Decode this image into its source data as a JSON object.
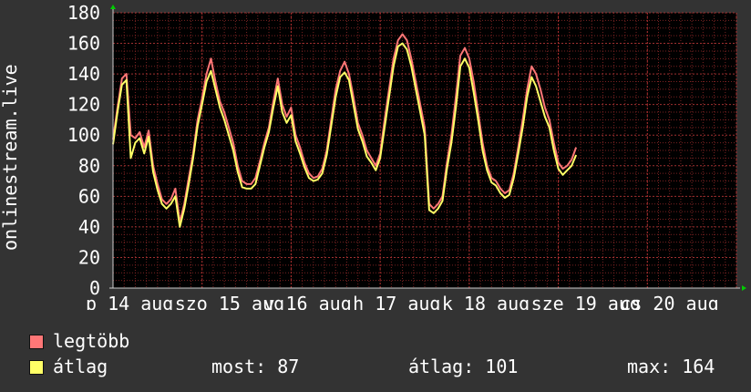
{
  "chart_data": {
    "type": "line",
    "ylabel": "onlinestream.live",
    "ylim": [
      0,
      180
    ],
    "y_ticks": [
      0,
      20,
      40,
      60,
      80,
      100,
      120,
      140,
      160,
      180
    ],
    "x_tick_labels": [
      "p 14 aug",
      "szo 15 aug",
      "v 16 aug",
      "h 17 aug",
      "k 18 aug",
      "sze 19 aug",
      "cs 20 aug"
    ],
    "grid": true,
    "colors": {
      "background": "#333333",
      "plot": "#000000",
      "grid": "#7a2222",
      "max_line": "#ff7777",
      "avg_line": "#ffff66",
      "text": "#ffffff"
    },
    "x_days": [
      14.0,
      14.05,
      14.1,
      14.15,
      14.2,
      14.25,
      14.3,
      14.35,
      14.4,
      14.45,
      14.5,
      14.55,
      14.6,
      14.65,
      14.7,
      14.75,
      14.8,
      14.85,
      14.9,
      14.95,
      15.0,
      15.05,
      15.1,
      15.15,
      15.2,
      15.25,
      15.3,
      15.35,
      15.4,
      15.45,
      15.5,
      15.55,
      15.6,
      15.65,
      15.7,
      15.75,
      15.8,
      15.85,
      15.9,
      15.95,
      16.0,
      16.05,
      16.1,
      16.15,
      16.2,
      16.25,
      16.3,
      16.35,
      16.4,
      16.45,
      16.5,
      16.55,
      16.6,
      16.65,
      16.7,
      16.75,
      16.8,
      16.85,
      16.9,
      16.95,
      17.0,
      17.05,
      17.1,
      17.15,
      17.2,
      17.25,
      17.3,
      17.35,
      17.4,
      17.45,
      17.5,
      17.55,
      17.6,
      17.65,
      17.7,
      17.75,
      17.8,
      17.85,
      17.9,
      17.95,
      18.0,
      18.05,
      18.1,
      18.15,
      18.2,
      18.25,
      18.3,
      18.35,
      18.4,
      18.45,
      18.5,
      18.55,
      18.6,
      18.65,
      18.7,
      18.75,
      18.8,
      18.85,
      18.9,
      18.95,
      19.0,
      19.05,
      19.1,
      19.15,
      19.2,
      19.25,
      19.3,
      19.35,
      19.4,
      19.45,
      19.5,
      19.55,
      19.6,
      19.65,
      19.7,
      19.75,
      19.8,
      19.85,
      19.9,
      19.95,
      20.0,
      20.05,
      20.1,
      20.15,
      20.2,
      20.25,
      20.3,
      20.35,
      20.4,
      20.45,
      20.5,
      20.55,
      20.6,
      20.65,
      20.7,
      20.75,
      20.8,
      20.85,
      20.9,
      20.95,
      21.0
    ],
    "series": [
      {
        "name": "legtöbb",
        "values": [
          97,
          118,
          137,
          140,
          100,
          98,
          102,
          92,
          103,
          80,
          68,
          58,
          55,
          58,
          65,
          43,
          55,
          72,
          88,
          110,
          124,
          140,
          150,
          135,
          122,
          115,
          105,
          95,
          80,
          70,
          68,
          68,
          72,
          83,
          95,
          105,
          122,
          137,
          120,
          112,
          118,
          100,
          92,
          82,
          75,
          72,
          73,
          78,
          90,
          110,
          130,
          142,
          148,
          140,
          125,
          108,
          100,
          90,
          85,
          80,
          88,
          110,
          130,
          150,
          162,
          166,
          162,
          150,
          135,
          120,
          105,
          55,
          52,
          55,
          60,
          82,
          100,
          125,
          152,
          157,
          150,
          135,
          115,
          95,
          80,
          72,
          70,
          65,
          62,
          64,
          75,
          92,
          110,
          130,
          145,
          140,
          130,
          118,
          110,
          95,
          82,
          78,
          80,
          84,
          92
        ]
      },
      {
        "name": "átlag",
        "values": [
          94,
          115,
          133,
          136,
          85,
          95,
          98,
          88,
          99,
          76,
          64,
          55,
          52,
          55,
          60,
          40,
          52,
          68,
          85,
          106,
          120,
          135,
          142,
          130,
          118,
          110,
          100,
          90,
          76,
          66,
          65,
          65,
          68,
          80,
          92,
          102,
          118,
          132,
          115,
          108,
          113,
          96,
          88,
          79,
          72,
          70,
          71,
          75,
          87,
          106,
          125,
          138,
          141,
          136,
          120,
          104,
          96,
          86,
          82,
          77,
          85,
          105,
          125,
          145,
          158,
          160,
          156,
          145,
          130,
          115,
          100,
          51,
          49,
          52,
          57,
          78,
          95,
          118,
          145,
          150,
          144,
          128,
          110,
          90,
          77,
          69,
          67,
          62,
          59,
          61,
          72,
          88,
          105,
          125,
          138,
          132,
          122,
          112,
          105,
          90,
          78,
          74,
          77,
          80,
          87
        ]
      }
    ]
  },
  "legend": {
    "items": [
      {
        "label": "legtöbb",
        "color": "#ff7777"
      },
      {
        "label": "átlag",
        "color": "#ffff66"
      }
    ]
  },
  "stats": {
    "now": "most: 87",
    "avg": "átlag: 101",
    "max": "max: 164"
  }
}
